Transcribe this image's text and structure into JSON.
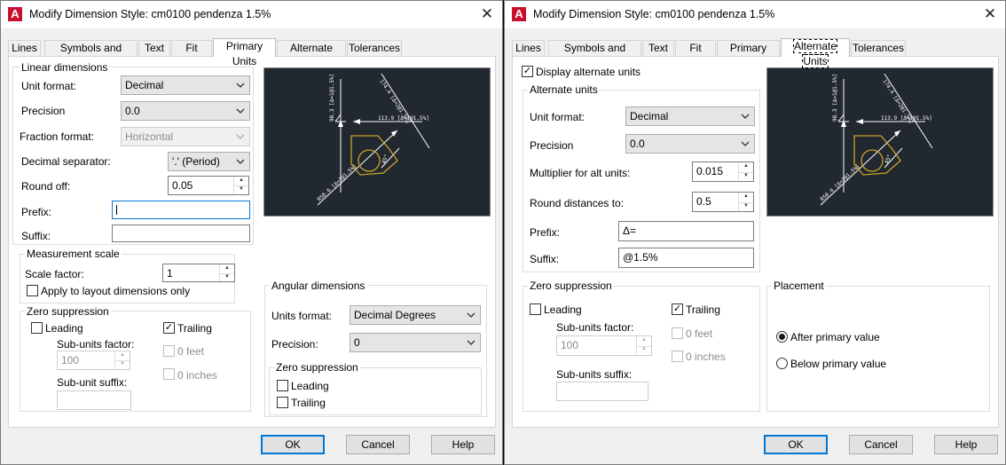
{
  "left": {
    "title": "Modify Dimension Style: cm0100 pendenza 1.5%",
    "tabs": [
      "Lines",
      "Symbols and Arrows",
      "Text",
      "Fit",
      "Primary Units",
      "Alternate Units",
      "Tolerances"
    ],
    "linear": {
      "group_label": "Linear dimensions",
      "unit_format_label": "Unit format:",
      "unit_format_value": "Decimal",
      "precision_label": "Precision",
      "precision_value": "0.0",
      "fraction_format_label": "Fraction format:",
      "fraction_format_value": "Horizontal",
      "decimal_separator_label": "Decimal separator:",
      "decimal_separator_value": "'.' (Period)",
      "round_off_label": "Round off:",
      "round_off_value": "0.05",
      "prefix_label": "Prefix:",
      "prefix_value": "",
      "suffix_label": "Suffix:",
      "suffix_value": ""
    },
    "measurement": {
      "group_label": "Measurement scale",
      "scale_factor_label": "Scale factor:",
      "scale_factor_value": "1",
      "apply_layout_label": "Apply to layout dimensions only"
    },
    "zero": {
      "group_label": "Zero suppression",
      "leading_label": "Leading",
      "trailing_label": "Trailing",
      "sub_units_factor_label": "Sub-units factor:",
      "sub_units_factor_value": "100",
      "sub_unit_suffix_label": "Sub-unit suffix:",
      "zero_feet_label": "0 feet",
      "zero_inches_label": "0 inches"
    },
    "angular": {
      "group_label": "Angular dimensions",
      "units_format_label": "Units format:",
      "units_format_value": "Decimal Degrees",
      "precision_label": "Precision:",
      "precision_value": "0",
      "zero_group_label": "Zero suppression",
      "leading_label": "Leading",
      "trailing_label": "Trailing"
    },
    "buttons": {
      "ok": "OK",
      "cancel": "Cancel",
      "help": "Help"
    }
  },
  "right": {
    "title": "Modify Dimension Style: cm0100 pendenza 1.5%",
    "tabs": [
      "Lines",
      "Symbols and Arrows",
      "Text",
      "Fit",
      "Primary Units",
      "Alternate Units",
      "Tolerances"
    ],
    "display_alt_label": "Display alternate units",
    "alt": {
      "group_label": "Alternate units",
      "unit_format_label": "Unit format:",
      "unit_format_value": "Decimal",
      "precision_label": "Precision",
      "precision_value": "0.0",
      "multiplier_label": "Multiplier for alt units:",
      "multiplier_value": "0.015",
      "round_label": "Round distances  to:",
      "round_value": "0.5",
      "prefix_label": "Prefix:",
      "prefix_value": "Δ=",
      "suffix_label": "Suffix:",
      "suffix_value": "@1.5%"
    },
    "zero": {
      "group_label": "Zero suppression",
      "leading_label": "Leading",
      "trailing_label": "Trailing",
      "sub_units_factor_label": "Sub-units factor:",
      "sub_units_factor_value": "100",
      "sub_units_suffix_label": "Sub-units suffix:",
      "zero_feet_label": "0 feet",
      "zero_inches_label": "0 inches"
    },
    "placement": {
      "group_label": "Placement",
      "after_label": "After primary value",
      "below_label": "Below primary value"
    },
    "buttons": {
      "ok": "OK",
      "cancel": "Cancel",
      "help": "Help"
    }
  },
  "colors": {
    "preview_bg": "#212830",
    "preview_shape": "#c9a227",
    "focus_blue": "#0078d7"
  }
}
